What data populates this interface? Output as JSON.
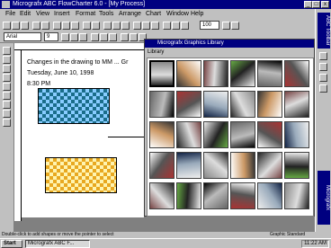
{
  "window": {
    "title": "Micrografx ABC FlowCharter 6.0 - [My Process]",
    "minimize": "_",
    "maximize": "□",
    "close": "x"
  },
  "menu": [
    "File",
    "Edit",
    "View",
    "Insert",
    "Format",
    "Tools",
    "Arrange",
    "Chart",
    "Window",
    "Help"
  ],
  "toolbar": {
    "zoom_value": "100",
    "font_value": "Arial",
    "size_value": "9"
  },
  "canvas": {
    "line1": "Changes in the drawing to MM ... Gr",
    "line2": "Tuesday, June 10, 1998",
    "line3": "8:30 PM"
  },
  "dialog": {
    "title": "Micrografx Graphics Library",
    "menu_label": "Library"
  },
  "right_palettes": [
    "ABC Toolbar",
    "Micrografx"
  ],
  "statusbar": {
    "left": "Double-click to add shapes or move the pointer to select",
    "right": "Graphic Standard"
  },
  "taskbar": {
    "start": "Start",
    "item": "Micrografx ABC F...",
    "clock": "11:22 AM"
  },
  "colors": {
    "title": "#000080",
    "face": "#c0c0c0",
    "shape1_base": "#1a6d8a",
    "shape2_base": "#e8a820"
  }
}
